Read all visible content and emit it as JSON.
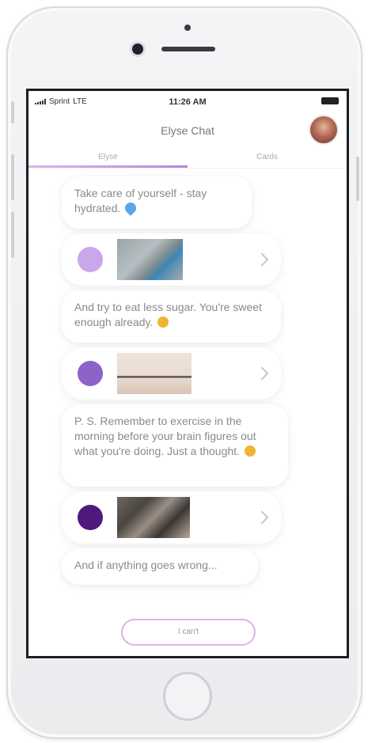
{
  "status": {
    "carrier": "Sprint",
    "network": "LTE",
    "time": "11:26 AM"
  },
  "header": {
    "title": "Elyse Chat"
  },
  "tabs": [
    {
      "label": "Elyse",
      "active": true
    },
    {
      "label": "Cards",
      "active": false
    }
  ],
  "messages": [
    {
      "type": "text",
      "text": "Take care of yourself - stay hydrated."
    },
    {
      "type": "card",
      "dot_color": "#c9a7ea",
      "image": "yoga-pose"
    },
    {
      "type": "text",
      "text": "And try to eat less sugar. You're sweet enough already."
    },
    {
      "type": "card",
      "dot_color": "#8d62c9",
      "image": "plank-exercise"
    },
    {
      "type": "text",
      "text": "P. S. Remember to exercise in the morning before your brain figures out what you're doing. Just a thought."
    },
    {
      "type": "card",
      "dot_color": "#4f1a7c",
      "image": "journal-desk"
    },
    {
      "type": "text",
      "text": "And if anything goes wrong..."
    }
  ],
  "reply": {
    "label": "I can't"
  },
  "colors": {
    "accent": "#b58ad4",
    "bubble_text": "#8a8a8a"
  }
}
